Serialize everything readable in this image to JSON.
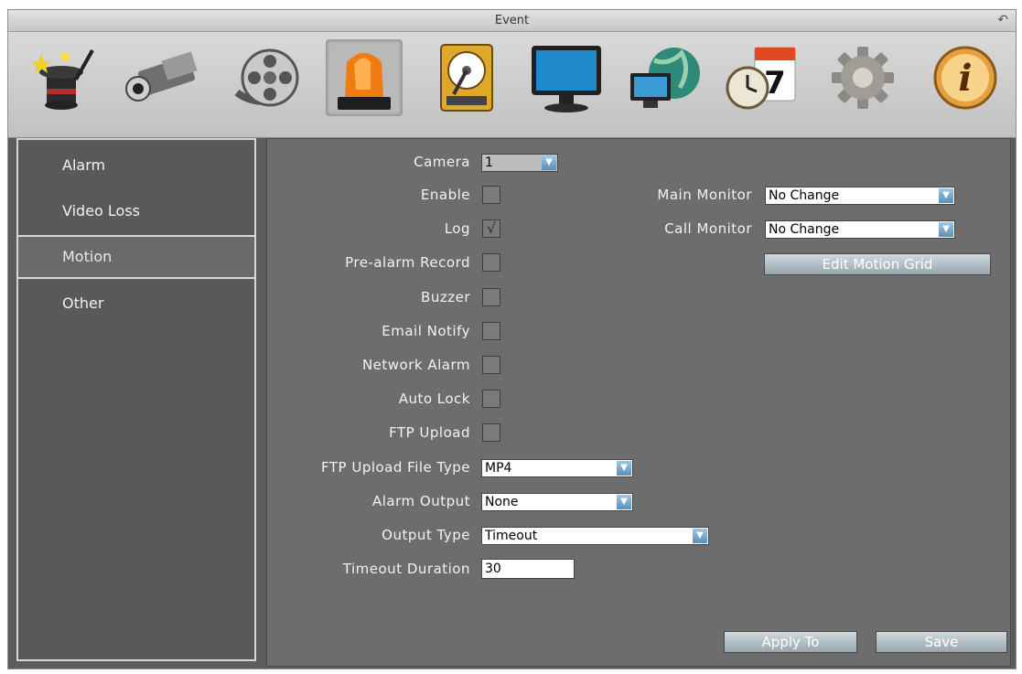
{
  "window": {
    "title": "Event"
  },
  "toolbar": {
    "icons": [
      "wizard-hat-icon",
      "camera-icon",
      "film-reel-icon",
      "alarm-siren-icon",
      "hard-disk-icon",
      "monitor-icon",
      "network-globe-icon",
      "schedule-clock-icon",
      "settings-gear-icon",
      "info-icon"
    ],
    "calendar_day": "7",
    "info_glyph": "i"
  },
  "sidebar": {
    "items": [
      {
        "label": "Alarm"
      },
      {
        "label": "Video Loss"
      },
      {
        "label": "Motion"
      },
      {
        "label": "Other"
      }
    ],
    "active": "Motion"
  },
  "form": {
    "camera_label": "Camera",
    "camera_value": "1",
    "enable_label": "Enable",
    "enable_checked": false,
    "log_label": "Log",
    "log_checked": true,
    "log_check_glyph": "√",
    "prealarm_label": "Pre-alarm Record",
    "buzzer_label": "Buzzer",
    "email_label": "Email Notify",
    "network_alarm_label": "Network Alarm",
    "auto_lock_label": "Auto Lock",
    "ftp_upload_label": "FTP Upload",
    "ftp_type_label": "FTP Upload File Type",
    "ftp_type_value": "MP4",
    "alarm_output_label": "Alarm Output",
    "alarm_output_value": "None",
    "output_type_label": "Output Type",
    "output_type_value": "Timeout",
    "timeout_label": "Timeout Duration",
    "timeout_value": "30",
    "main_monitor_label": "Main Monitor",
    "main_monitor_value": "No Change",
    "call_monitor_label": "Call Monitor",
    "call_monitor_value": "No Change",
    "edit_grid_label": "Edit Motion Grid",
    "apply_label": "Apply To",
    "save_label": "Save"
  },
  "colors": {
    "accent": "#5a8fb9",
    "panel": "#6d6d6d",
    "active_border": "#d8d8d8"
  }
}
